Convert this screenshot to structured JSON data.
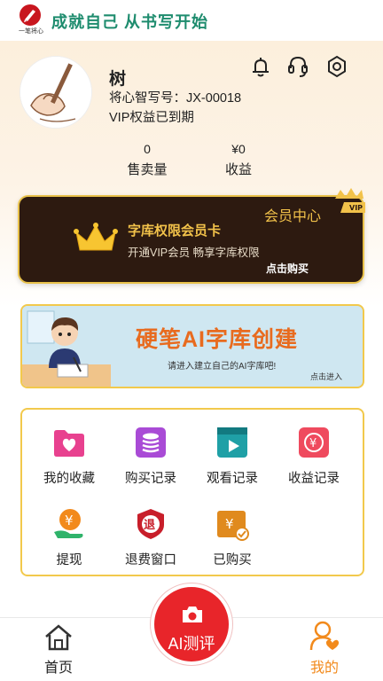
{
  "top_bar": {
    "logo_text": "一笔将心",
    "slogan": "成就自己  从书写开始"
  },
  "profile": {
    "name": "树",
    "id_line": "将心智写号：JX-00018",
    "vip_status": "VIP权益已到期",
    "icons": [
      "bell-icon",
      "headset-icon",
      "settings-icon"
    ]
  },
  "stats": [
    {
      "value": "0",
      "label": "售卖量"
    },
    {
      "value": "¥0",
      "label": "收益"
    }
  ],
  "vip_card": {
    "center_label": "会员中心",
    "badge": "VIP",
    "title": "字库权限会员卡",
    "subtitle": "开通VIP会员   畅享字库权限",
    "buy_label": "点击购买"
  },
  "banner": {
    "title": "硬笔AI字库创建",
    "subtitle": "请进入建立自己的AI字库吧!",
    "cta": "点击进入"
  },
  "menu": [
    {
      "label": "我的收藏",
      "icon": "favorites-icon",
      "color": "#e8418f"
    },
    {
      "label": "购买记录",
      "icon": "purchase-records-icon",
      "color": "#a94bd6"
    },
    {
      "label": "观看记录",
      "icon": "watch-records-icon",
      "color": "#1fa0a6"
    },
    {
      "label": "收益记录",
      "icon": "earnings-records-icon",
      "color": "#ef4a5e"
    },
    {
      "label": "提现",
      "icon": "withdraw-icon",
      "color": "#f28a1c"
    },
    {
      "label": "退费窗口",
      "icon": "refund-icon",
      "color": "#c81e2a"
    },
    {
      "label": "已购买",
      "icon": "purchased-icon",
      "color": "#e08a1e"
    }
  ],
  "tabbar": {
    "home_label": "首页",
    "center_label": "AI测评",
    "mine_label": "我的",
    "active_color": "#f28a1c"
  }
}
